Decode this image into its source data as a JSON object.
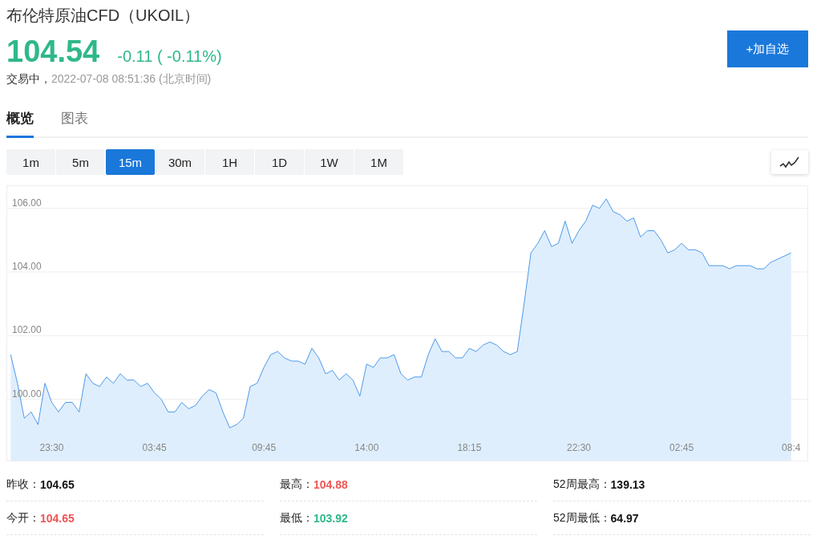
{
  "title": "布伦特原油CFD（UKOIL）",
  "quote": {
    "price": "104.54",
    "change": "-0.11 ( -0.11%)"
  },
  "status": {
    "state": "交易中，",
    "time": "2022-07-08 08:51:36 (北京时间)"
  },
  "watch_button": "+加自选",
  "tabs": [
    {
      "label": "概览",
      "selected": true
    },
    {
      "label": "图表",
      "selected": false
    }
  ],
  "periods": [
    {
      "label": "1m",
      "selected": false
    },
    {
      "label": "5m",
      "selected": false
    },
    {
      "label": "15m",
      "selected": true
    },
    {
      "label": "30m",
      "selected": false
    },
    {
      "label": "1H",
      "selected": false
    },
    {
      "label": "1D",
      "selected": false
    },
    {
      "label": "1W",
      "selected": false
    },
    {
      "label": "1M",
      "selected": false
    }
  ],
  "chart_data": {
    "type": "area",
    "grid": true,
    "ylim": [
      98.07,
      106.7
    ],
    "categories": [
      null,
      null,
      null,
      null,
      null,
      null,
      "23:30",
      null,
      null,
      null,
      null,
      null,
      null,
      null,
      null,
      null,
      null,
      null,
      null,
      null,
      null,
      "03:45",
      null,
      null,
      null,
      null,
      null,
      null,
      null,
      null,
      null,
      null,
      null,
      null,
      null,
      null,
      null,
      "09:45",
      null,
      null,
      null,
      null,
      null,
      null,
      null,
      null,
      null,
      null,
      null,
      null,
      null,
      null,
      "14:00",
      null,
      null,
      null,
      null,
      null,
      null,
      null,
      null,
      null,
      null,
      null,
      null,
      null,
      null,
      "18:15",
      null,
      null,
      null,
      null,
      null,
      null,
      null,
      null,
      null,
      null,
      null,
      null,
      null,
      null,
      null,
      "22:30",
      null,
      null,
      null,
      null,
      null,
      null,
      null,
      null,
      null,
      null,
      null,
      null,
      null,
      null,
      "02:45",
      null,
      null,
      null,
      null,
      null,
      null,
      null,
      null,
      null,
      null,
      null,
      null,
      null,
      null,
      null,
      "08:4"
    ],
    "yticks": [
      {
        "value": 100,
        "label": "100.00"
      },
      {
        "value": 102,
        "label": "102.00"
      },
      {
        "value": 104,
        "label": "104.00"
      },
      {
        "value": 106,
        "label": "106.00"
      }
    ],
    "series": [
      {
        "color": "#3a8ee6",
        "values": [
          101.4,
          100.5,
          99.4,
          99.6,
          99.2,
          100.5,
          99.9,
          99.6,
          99.9,
          99.9,
          99.6,
          100.8,
          100.5,
          100.4,
          100.7,
          100.5,
          100.8,
          100.6,
          100.6,
          100.4,
          100.5,
          100.2,
          100.0,
          99.6,
          99.6,
          99.9,
          99.7,
          99.8,
          100.1,
          100.3,
          100.2,
          99.6,
          99.1,
          99.2,
          99.4,
          100.4,
          100.5,
          101.0,
          101.4,
          101.5,
          101.3,
          101.2,
          101.2,
          101.1,
          101.6,
          101.3,
          100.8,
          100.9,
          100.6,
          100.8,
          100.6,
          100.1,
          101.1,
          101.0,
          101.3,
          101.3,
          101.4,
          100.8,
          100.6,
          100.7,
          100.7,
          101.4,
          101.9,
          101.5,
          101.5,
          101.3,
          101.3,
          101.6,
          101.5,
          101.7,
          101.8,
          101.7,
          101.5,
          101.4,
          101.5,
          103.0,
          104.6,
          104.9,
          105.3,
          104.8,
          104.9,
          105.6,
          104.9,
          105.3,
          105.6,
          106.1,
          106.0,
          106.3,
          105.9,
          105.8,
          105.6,
          105.7,
          105.1,
          105.3,
          105.3,
          105.0,
          104.6,
          104.7,
          104.9,
          104.7,
          104.7,
          104.6,
          104.2,
          104.2,
          104.2,
          104.1,
          104.2,
          104.2,
          104.2,
          104.1,
          104.1,
          104.3,
          104.4,
          104.5,
          104.6
        ]
      }
    ]
  },
  "stats": [
    {
      "label": "昨收：",
      "value": "104.65",
      "color": "#111111"
    },
    {
      "label": "最高：",
      "value": "104.88",
      "color": "#f05454"
    },
    {
      "label": "52周最高：",
      "value": "139.13",
      "color": "#111111"
    },
    {
      "label": "今开：",
      "value": "104.65",
      "color": "#f05454"
    },
    {
      "label": "最低：",
      "value": "103.92",
      "color": "#2fb88a"
    },
    {
      "label": "52周最低：",
      "value": "64.97",
      "color": "#111111"
    }
  ]
}
